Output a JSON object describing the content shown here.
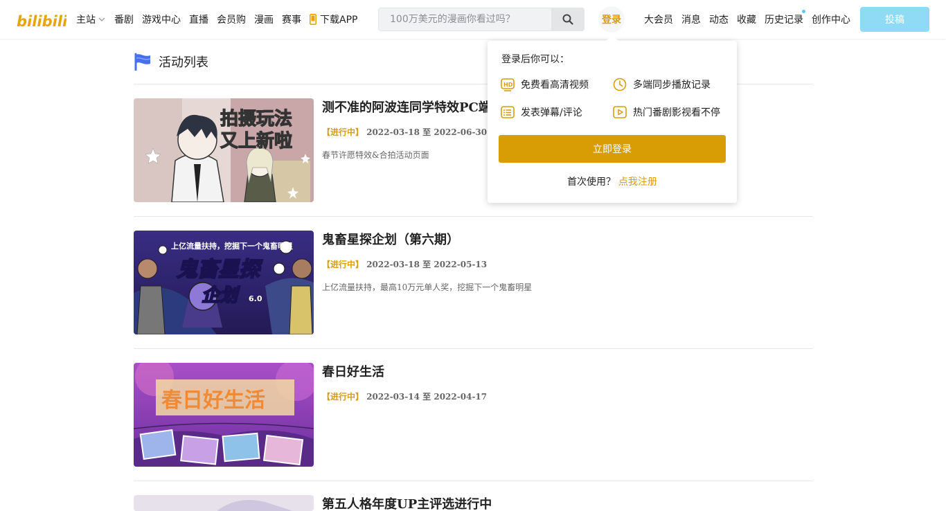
{
  "header": {
    "logo_text": "bilibili",
    "nav": [
      "主站",
      "番剧",
      "游戏中心",
      "直播",
      "会员购",
      "漫画",
      "赛事"
    ],
    "download_app": "下载APP",
    "search_placeholder": "100万美元的漫画你看过吗？",
    "login": "登录",
    "right_nav": [
      "大会员",
      "消息",
      "动态",
      "收藏",
      "历史记录",
      "创作中心"
    ],
    "upload": "投稿"
  },
  "section": {
    "title": "活动列表"
  },
  "activities": [
    {
      "title": "测不准的阿波连同学特效PC端",
      "status": "【进行中】",
      "start": "2022-03-18",
      "sep": "至",
      "end": "2022-06-30",
      "desc": "春节许愿特效&合拍活动页面",
      "thumb_text": [
        "拍摄玩法",
        "又上新啦"
      ]
    },
    {
      "title": "鬼畜星探企划（第六期）",
      "status": "【进行中】",
      "start": "2022-03-18",
      "sep": "至",
      "end": "2022-05-13",
      "desc": "上亿流量扶持，最高10万元单人奖，挖掘下一个鬼畜明星",
      "thumb_text": [
        "上亿流量扶持，挖掘下一个鬼畜明星",
        "鬼畜星探",
        "企划",
        "6.0"
      ]
    },
    {
      "title": "春日好生活",
      "status": "【进行中】",
      "start": "2022-03-14",
      "sep": "至",
      "end": "2022-04-17",
      "desc": "",
      "thumb_text": [
        "春日好生活"
      ]
    },
    {
      "title": "第五人格年度UP主评选进行中",
      "status": "",
      "start": "",
      "sep": "",
      "end": "",
      "desc": "",
      "thumb_text": []
    }
  ],
  "popup": {
    "heading": "登录后你可以：",
    "features": [
      "免费看高清视频",
      "多端同步播放记录",
      "发表弹幕/评论",
      "热门番剧影视看不停"
    ],
    "login_now": "立即登录",
    "first_use": "首次使用？",
    "register": "点我注册"
  },
  "colors": {
    "accent": "#d89c0c",
    "upload": "#8fdbf6",
    "login_btn": "#d89c05"
  }
}
